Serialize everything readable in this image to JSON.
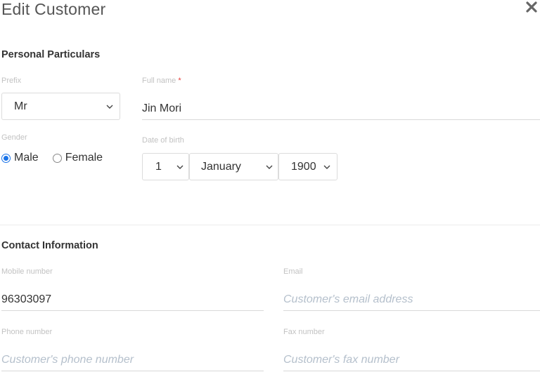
{
  "dialog": {
    "title": "Edit Customer"
  },
  "personal": {
    "section_title": "Personal Particulars",
    "prefix": {
      "label": "Prefix",
      "value": "Mr"
    },
    "full_name": {
      "label": "Full name",
      "required_mark": "*",
      "value": "Jin Mori"
    },
    "gender": {
      "label": "Gender",
      "options": [
        "Male",
        "Female"
      ],
      "selected": "Male"
    },
    "dob": {
      "label": "Date of birth",
      "day": "1",
      "month": "January",
      "year": "1900"
    }
  },
  "contact": {
    "section_title": "Contact Information",
    "mobile": {
      "label": "Mobile number",
      "value": "96303097",
      "placeholder": ""
    },
    "email": {
      "label": "Email",
      "value": "",
      "placeholder": "Customer's email address"
    },
    "phone": {
      "label": "Phone number",
      "value": "",
      "placeholder": "Customer's phone number"
    },
    "fax": {
      "label": "Fax number",
      "value": "",
      "placeholder": "Customer's fax number"
    }
  },
  "colors": {
    "accent": "#1a73e8",
    "required": "#e53935",
    "placeholder": "#b5c0cc"
  }
}
